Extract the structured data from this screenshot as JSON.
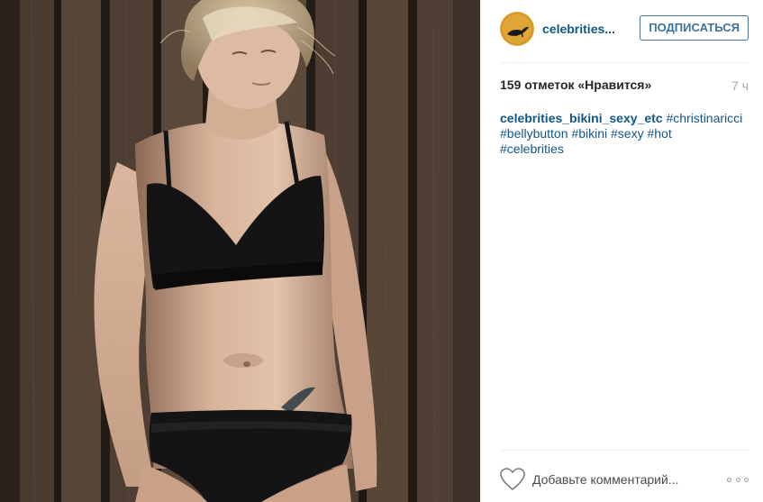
{
  "post": {
    "image": {
      "description_icon": "photo"
    },
    "header": {
      "username": "celebrities...",
      "follow_label": "ПОДПИСАТЬСЯ",
      "avatar_icon": "avatar-icon"
    },
    "stats": {
      "likes_text": "159 отметок «Нравится»",
      "time_ago": "7 ч"
    },
    "caption": {
      "author": "celebrities_bikini_sexy_etc",
      "tags": [
        "#christinaricci",
        "#bellybutton",
        "#bikini",
        "#sexy",
        "#hot",
        "#celebrities"
      ]
    },
    "actions": {
      "comment_placeholder": "Добавьте комментарий...",
      "like_icon": "heart-icon",
      "more_icon": "more-options-icon"
    }
  },
  "colors": {
    "link": "#125688",
    "follow": "#3f729b",
    "muted": "#a5a7aa",
    "text": "#262626",
    "divider": "#efefef"
  }
}
